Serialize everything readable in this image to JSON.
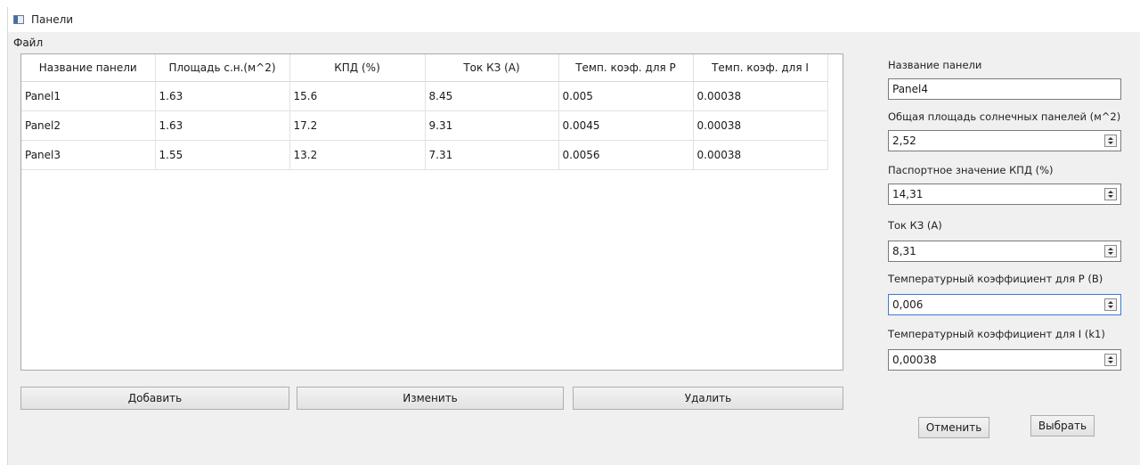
{
  "window": {
    "title": "Панели"
  },
  "menu": {
    "file": "Файл"
  },
  "table": {
    "columns": [
      "Название панели",
      "Площадь с.н.(м^2)",
      "КПД (%)",
      "Ток КЗ (А)",
      "Темп. коэф. для P",
      "Темп. коэф. для I"
    ],
    "rows": [
      [
        "Panel1",
        "1.63",
        "15.6",
        "8.45",
        "0.005",
        "0.00038"
      ],
      [
        "Panel2",
        "1.63",
        "17.2",
        "9.31",
        "0.0045",
        "0.00038"
      ],
      [
        "Panel3",
        "1.55",
        "13.2",
        "7.31",
        "0.0056",
        "0.00038"
      ]
    ]
  },
  "buttons": {
    "add": "Добавить",
    "edit": "Изменить",
    "delete": "Удалить",
    "cancel": "Отменить",
    "select": "Выбрать"
  },
  "form": {
    "name_label": "Название панели",
    "name_value": "Panel4",
    "area_label": "Общая площадь солнечных панелей (м^2)",
    "area_value": "2,52",
    "eff_label": "Паспортное значение КПД (%)",
    "eff_value": "14,31",
    "isc_label": "Ток КЗ (А)",
    "isc_value": "8,31",
    "beta_label": "Температурный коэффициент для P (B)",
    "beta_value": "0,006",
    "k1_label": "Температурный коэффициент для I (k1)",
    "k1_value": "0,00038"
  }
}
